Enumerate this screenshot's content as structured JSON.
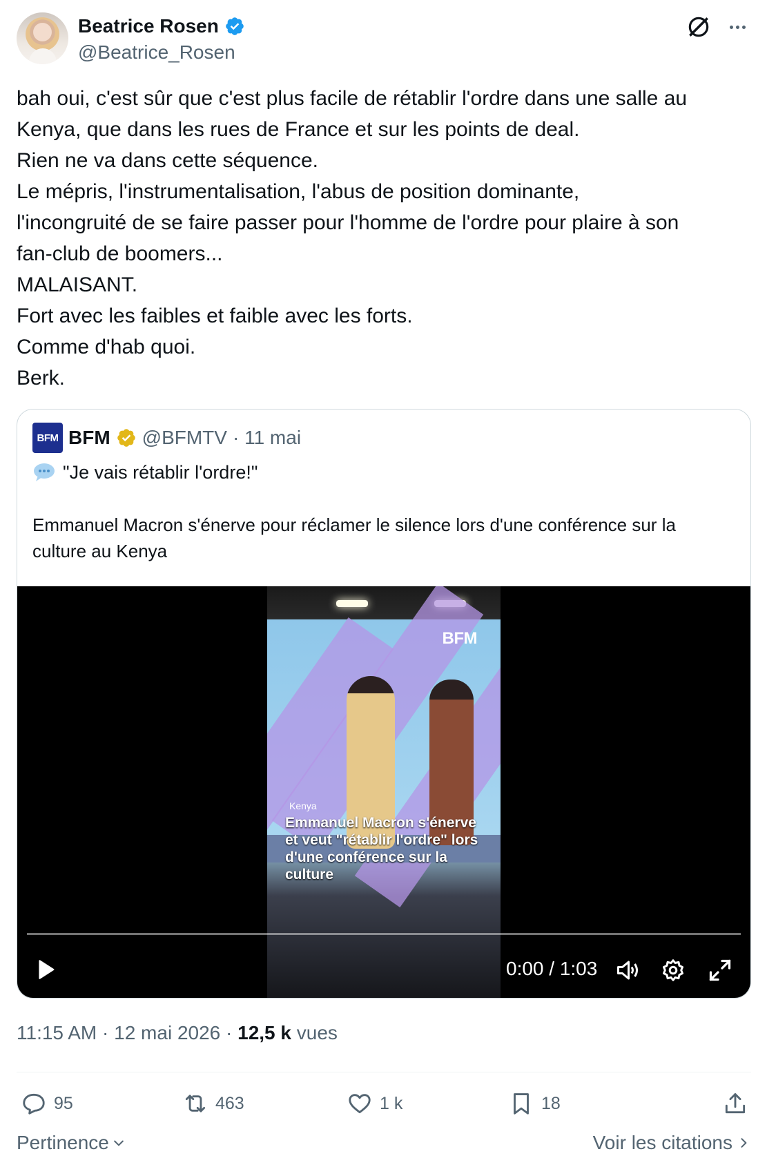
{
  "author": {
    "display_name": "Beatrice Rosen",
    "handle": "@Beatrice_Rosen"
  },
  "tweet": {
    "lines": [
      "bah oui, c'est sûr que c'est plus facile de rétablir l'ordre dans une salle au",
      "Kenya, que dans les rues de France et sur les points de deal.",
      "Rien ne va dans cette séquence.",
      "Le mépris, l'instrumentalisation, l'abus de position dominante,",
      "l'incongruité de se faire passer pour l'homme de l'ordre pour plaire à son",
      "fan-club de boomers...",
      "MALAISANT.",
      "Fort avec les faibles et faible avec les forts.",
      "Comme d'hab quoi.",
      "Berk."
    ]
  },
  "quote": {
    "logo_text": "BFM",
    "name": "BFM",
    "handle": "@BFMTV",
    "date": "· 11 mai",
    "line1": "\"Je vais rétablir l'ordre!\"",
    "body": "Emmanuel Macron s'énerve pour réclamer le silence lors d'une conférence sur la culture au Kenya",
    "video": {
      "watermark": "BFM",
      "location": "Kenya",
      "caption": "Emmanuel Macron s'énerve et veut \"rétablir l'ordre\" lors d'une conférence sur la culture",
      "time": "0:00 / 1:03",
      "progress": 0
    }
  },
  "meta": {
    "time": "11:15 AM",
    "date": "12 mai 2026",
    "views_count": "12,5 k",
    "views_label": "vues"
  },
  "actions": {
    "replies": "95",
    "reposts": "463",
    "likes": "1 k",
    "bookmarks": "18"
  },
  "footer": {
    "sort_label": "Pertinence",
    "quotes_link": "Voir les citations"
  },
  "colors": {
    "verified_blue": "#1d9bf0",
    "gold_badge": "#e2b719",
    "secondary_text": "#536471",
    "bfm_blue": "#1d2f8f"
  }
}
